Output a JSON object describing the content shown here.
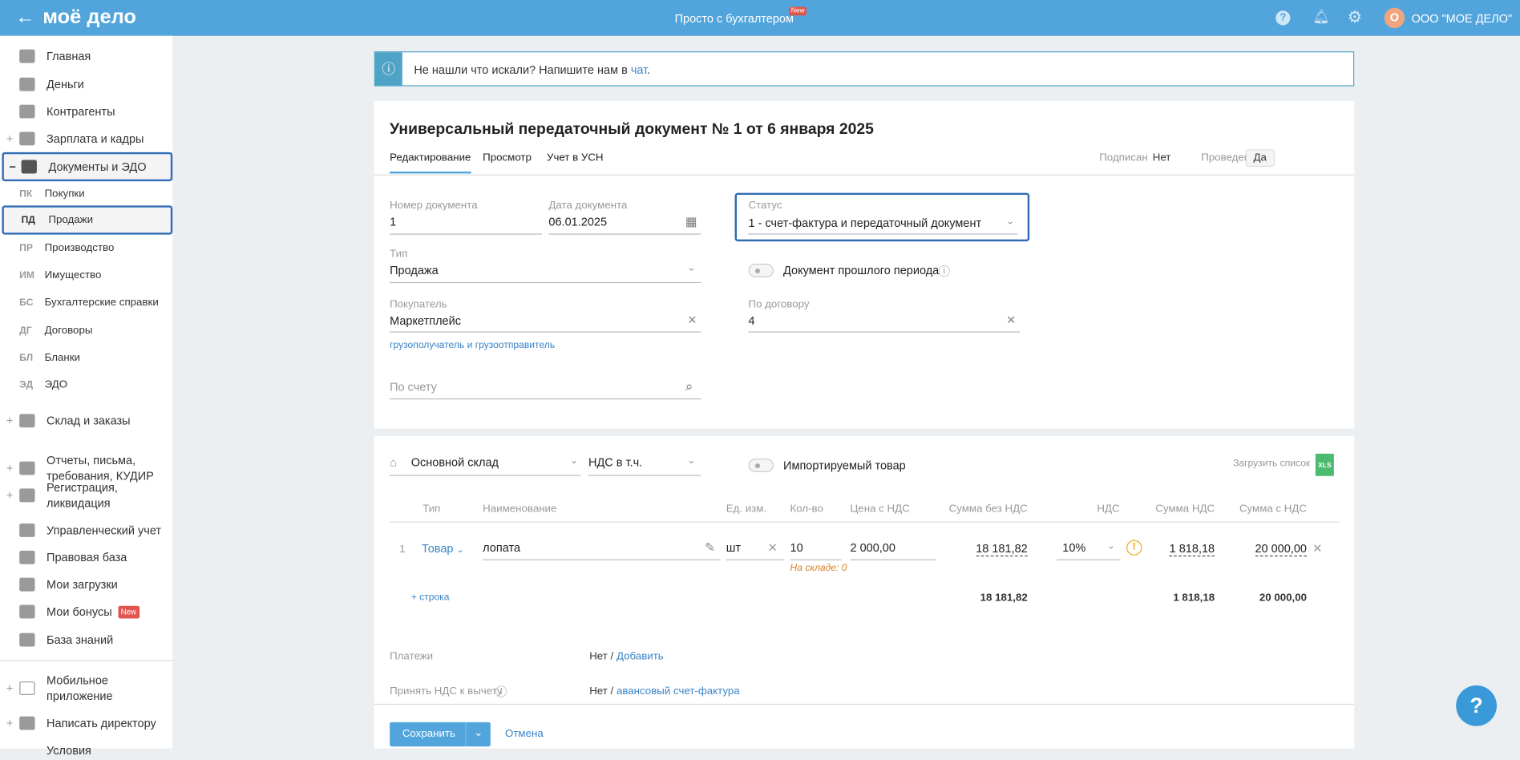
{
  "header": {
    "logo": "моё дело",
    "center_link": "Просто с бухгалтером",
    "center_badge": "New",
    "avatar_letter": "О",
    "company": "ООО \"МОЕ ДЕЛО\""
  },
  "sidebar": {
    "items": [
      {
        "label": "Главная"
      },
      {
        "label": "Деньги"
      },
      {
        "label": "Контрагенты"
      },
      {
        "label": "Зарплата и кадры"
      },
      {
        "label": "Документы и ЭДО"
      }
    ],
    "sub": [
      {
        "abbr": "ПК",
        "label": "Покупки"
      },
      {
        "abbr": "ПД",
        "label": "Продажи"
      },
      {
        "abbr": "ПР",
        "label": "Производство"
      },
      {
        "abbr": "ИМ",
        "label": "Имущество"
      },
      {
        "abbr": "БС",
        "label": "Бухгалтерские справки"
      },
      {
        "abbr": "ДГ",
        "label": "Договоры"
      },
      {
        "abbr": "БЛ",
        "label": "Бланки"
      },
      {
        "abbr": "ЭД",
        "label": "ЭДО"
      }
    ],
    "items2": [
      {
        "label": "Склад и заказы"
      },
      {
        "label": "Отчеты, письма, требования, КУДИР"
      },
      {
        "label": "Регистрация, ликвидация"
      },
      {
        "label": "Управленческий учет"
      },
      {
        "label": "Правовая база"
      },
      {
        "label": "Мои загрузки"
      },
      {
        "label": "Мои бонусы",
        "badge": "New"
      },
      {
        "label": "База знаний"
      }
    ],
    "items3": [
      {
        "label": "Мобильное приложение"
      },
      {
        "label": "Написать директору"
      },
      {
        "label": "Условия"
      }
    ]
  },
  "info": {
    "text": "Не нашли что искали? Напишите нам в ",
    "link": "чат",
    "end": "."
  },
  "doc": {
    "title": "Универсальный передаточный документ № 1 от 6 января 2025",
    "tabs": [
      "Редактирование",
      "Просмотр",
      "Учет в УСН"
    ],
    "signed_label": "Подписан",
    "signed_value": "Нет",
    "posted_label": "Проведен",
    "posted_value": "Да",
    "number_label": "Номер документа",
    "number": "1",
    "date_label": "Дата документа",
    "date": "06.01.2025",
    "status_label": "Статус",
    "status": "1 - счет-фактура и передаточный документ",
    "type_label": "Тип",
    "type": "Продажа",
    "past_period": "Документ прошлого периода",
    "buyer_label": "Покупатель",
    "buyer": "Маркетплейс",
    "contract_label": "По договору",
    "contract": "4",
    "consignee_link": "грузополучатель и грузоотправитель",
    "invoice_placeholder": "По счету"
  },
  "goods": {
    "warehouse": "Основной склад",
    "vat_mode": "НДС в т.ч.",
    "imported": "Импортируемый товар",
    "upload": "Загрузить список",
    "xls": "XLS",
    "columns": [
      "Тип",
      "Наименование",
      "Ед. изм.",
      "Кол-во",
      "Цена с НДС",
      "Сумма без НДС",
      "НДС",
      "Сумма НДС",
      "Сумма с НДС"
    ],
    "rows": [
      {
        "n": "1",
        "type": "Товар",
        "name": "лопата",
        "unit": "шт",
        "qty": "10",
        "price": "2 000,00",
        "sum_no_vat": "18 181,82",
        "vat": "10%",
        "vat_sum": "1 818,18",
        "total": "20 000,00",
        "stock": "На складе: 0"
      }
    ],
    "add_row": "строка",
    "totals": {
      "sum_no_vat": "18 181,82",
      "vat_sum": "1 818,18",
      "total": "20 000,00"
    }
  },
  "payments": {
    "label": "Платежи",
    "value": "Нет",
    "link": "Добавить"
  },
  "vat_deduct": {
    "label": "Принять НДС к вычету",
    "value": "Нет",
    "link": "авансовый счет-фактура"
  },
  "footer": {
    "save": "Сохранить",
    "cancel": "Отмена"
  },
  "colors": {
    "header": "#52a5dc",
    "accent": "#3a84c7",
    "highlight": "#2f6cb5",
    "badge": "#e0564f"
  }
}
